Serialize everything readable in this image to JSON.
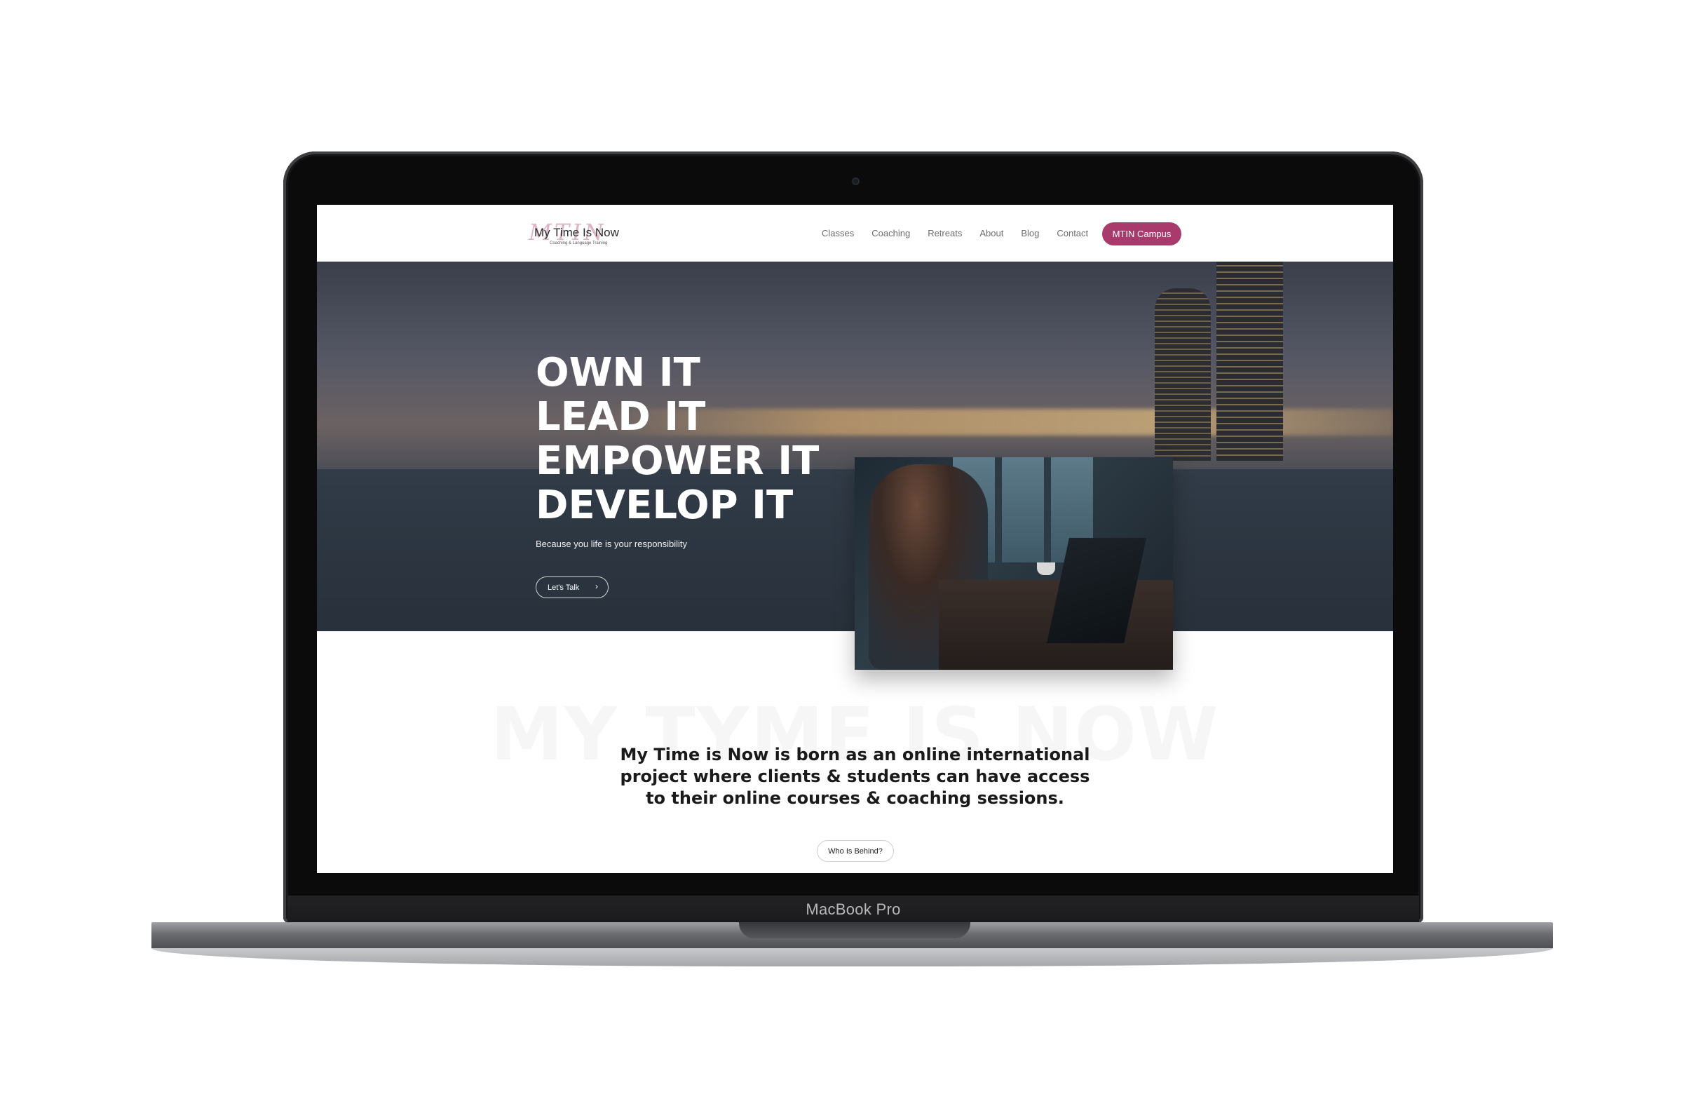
{
  "device": {
    "label": "MacBook Pro"
  },
  "header": {
    "logo_name": "My Time Is Now",
    "logo_monogram": "MTIN",
    "logo_tagline": "Coaching & Language Training",
    "menu": [
      "Classes",
      "Coaching",
      "Retreats",
      "About",
      "Blog",
      "Contact"
    ],
    "cta_label": "MTIN Campus",
    "cta_color": "#a83a6c"
  },
  "hero": {
    "lines": [
      "OWN IT",
      "LEAD IT",
      "EMPOWER IT",
      "DEVELOP IT"
    ],
    "subtitle": "Because you life is your responsibility",
    "button_label": "Let's Talk",
    "button_icon": "chevron-right-icon"
  },
  "intro": {
    "background_text": "MY TYME IS NOW",
    "text": "My Time is Now is born as an online international project where clients & students can have access to their online courses & coaching sessions.",
    "button_label": "Who Is Behind?"
  }
}
